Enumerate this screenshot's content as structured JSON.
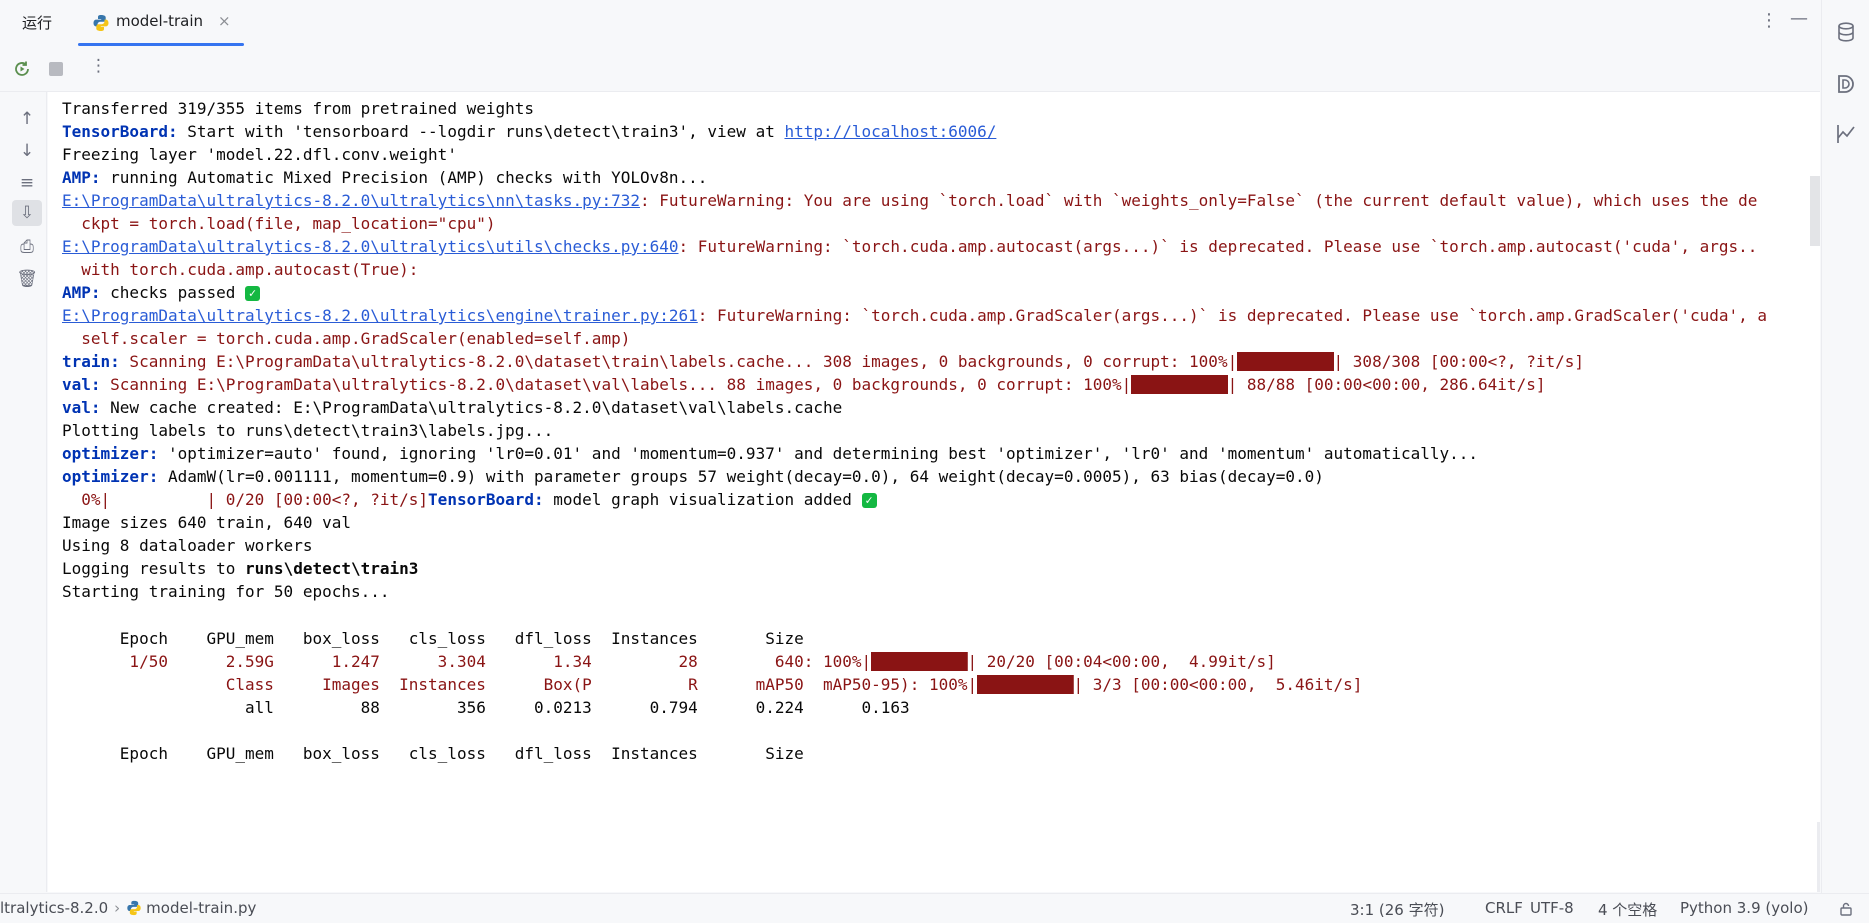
{
  "tabs": {
    "run_label": "运行",
    "config_name": "model-train",
    "close_glyph": "×",
    "more_glyph": "⋮",
    "minimize_glyph": "—"
  },
  "toolbar": {
    "more_glyph": "⋮",
    "icons": [
      "rerun-icon",
      "stop-icon",
      "more-options-icon"
    ]
  },
  "gutter": {
    "icons": [
      "scroll-up-icon",
      "scroll-down-icon",
      "soft-wrap-icon",
      "scroll-to-end-icon",
      "print-icon",
      "trash-icon"
    ],
    "glyphs": [
      "↑",
      "↓",
      "≡",
      "⇩",
      "⎙",
      "🗑"
    ]
  },
  "console": {
    "l1": "Transferred 319/355 items from pretrained weights",
    "l2_kw": "TensorBoard:",
    "l2_text": " Start with 'tensorboard --logdir runs\\detect\\train3', view at ",
    "l2_link": "http://localhost:6006/",
    "l3": "Freezing layer 'model.22.dfl.conv.weight'",
    "l4_kw": "AMP:",
    "l4_text": " running Automatic Mixed Precision (AMP) checks with YOLOv8n...",
    "l5_link": "E:\\ProgramData\\ultralytics-8.2.0\\ultralytics\\nn\\tasks.py:732",
    "l5_text": ": FutureWarning: You are using `torch.load` with `weights_only=False` (the current default value), which uses the de",
    "l6": "  ckpt = torch.load(file, map_location=\"cpu\")",
    "l7_link": "E:\\ProgramData\\ultralytics-8.2.0\\ultralytics\\utils\\checks.py:640",
    "l7_text": ": FutureWarning: `torch.cuda.amp.autocast(args...)` is deprecated. Please use `torch.amp.autocast('cuda', args..",
    "l8": "  with torch.cuda.amp.autocast(True):",
    "l9_kw": "AMP:",
    "l9_text": " checks passed ",
    "l10_link": "E:\\ProgramData\\ultralytics-8.2.0\\ultralytics\\engine\\trainer.py:261",
    "l10_text": ": FutureWarning: `torch.cuda.amp.GradScaler(args...)` is deprecated. Please use `torch.amp.GradScaler('cuda', a",
    "l11": "  self.scaler = torch.cuda.amp.GradScaler(enabled=self.amp)",
    "l12_kw": "train:",
    "l12_text": " Scanning E:\\ProgramData\\ultralytics-8.2.0\\dataset\\train\\labels.cache... 308 images, 0 backgrounds, 0 corrupt: 100%|",
    "l12_bar": "██████████",
    "l12_tail": "| 308/308 [00:00<?, ?it/s]",
    "l13_kw": "val:",
    "l13_text": " Scanning E:\\ProgramData\\ultralytics-8.2.0\\dataset\\val\\labels... 88 images, 0 backgrounds, 0 corrupt: 100%|",
    "l13_bar": "██████████",
    "l13_tail": "| 88/88 [00:00<00:00, 286.64it/s]",
    "l14_kw": "val:",
    "l14_text": " New cache created: E:\\ProgramData\\ultralytics-8.2.0\\dataset\\val\\labels.cache",
    "l15": "Plotting labels to runs\\detect\\train3\\labels.jpg...",
    "l16_kw": "optimizer:",
    "l16_text": " 'optimizer=auto' found, ignoring 'lr0=0.01' and 'momentum=0.937' and determining best 'optimizer', 'lr0' and 'momentum' automatically...",
    "l17_kw": "optimizer:",
    "l17_text": " AdamW(lr=0.001111, momentum=0.9) with parameter groups 57 weight(decay=0.0), 64 weight(decay=0.0005), 63 bias(decay=0.0)",
    "l18_red": "  0%|          | 0/20 [00:00<?, ?it/s]",
    "l18_kw": "TensorBoard:",
    "l18_text": " model graph visualization added ",
    "l19": "Image sizes 640 train, 640 val",
    "l20": "Using 8 dataloader workers",
    "l21_text": "Logging results to ",
    "l21_strong": "runs\\detect\\train3",
    "l22": "Starting training for 50 epochs...",
    "hdr1": "      Epoch    GPU_mem   box_loss   cls_loss   dfl_loss  Instances       Size",
    "ep1": "       1/50      2.59G      1.247      3.304       1.34         28        640: 100%|",
    "ep1_bar": "██████████",
    "ep1_tail": "| 20/20 [00:04<00:00,  4.99it/s]",
    "val1": "                 Class     Images  Instances      Box(P          R      mAP50  mAP50-95): 100%|",
    "val1_bar": "██████████",
    "val1_tail": "| 3/3 [00:00<00:00,  5.46it/s]",
    "all1": "                   all         88        356     0.0213      0.794      0.224      0.163",
    "hdr2": "      Epoch    GPU_mem   box_loss   cls_loss   dfl_loss  Instances       Size",
    "check_glyph": "✓"
  },
  "statusbar": {
    "project": "ltralytics-8.2.0",
    "sep": "›",
    "file": "model-train.py",
    "position": "3:1 (26 字符)",
    "line_ending": "CRLF",
    "encoding": "UTF-8",
    "indent": "4 个空格",
    "interpreter": "Python 3.9 (yolo)"
  },
  "rightbar": {
    "icons": [
      "database-icon",
      "d-plugin-icon",
      "chart-icon"
    ]
  },
  "colors": {
    "accent": "#3574f0",
    "error_red": "#8a1414",
    "keyword_blue": "#0033b3",
    "link_blue": "#2a5cd6",
    "success_green": "#14b842"
  }
}
